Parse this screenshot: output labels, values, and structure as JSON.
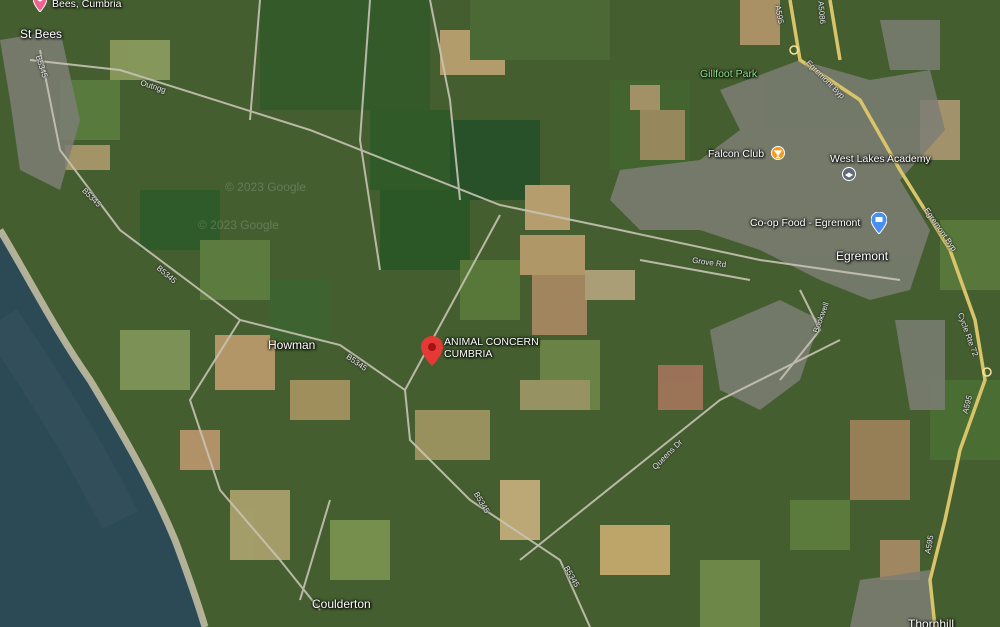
{
  "map": {
    "labels": {
      "st_bees": "St Bees",
      "st_bees_poi": "Bees, Cumbria",
      "howman": "Howman",
      "coulderton": "Coulderton",
      "egremont": "Egremont",
      "thornhill": "Thornhill"
    },
    "roads": {
      "b5345_a": "B5345",
      "b5345_b": "B5345",
      "b5345_c": "B5345",
      "b5345_d": "B5345",
      "b5345_e": "B5345",
      "b5345_f": "B5345",
      "a595_a": "A595",
      "a595_b": "A595",
      "a595_c": "A595",
      "a5086": "A5086",
      "egremont_byp_a": "Egremont Byp",
      "egremont_byp_b": "Egremont Byp",
      "outrigg": "Outrigg",
      "grove_rd": "Grove Rd",
      "queens_dr": "Queens Dr",
      "bookwell": "Bookwell",
      "cycle_rte": "Cycle Rte 72"
    },
    "pois": {
      "animal_concern": "ANIMAL CONCERN CUMBRIA",
      "gillfoot_park": "Gillfoot Park",
      "falcon_club": "Falcon Club",
      "west_lakes_academy": "West Lakes Academy",
      "coop_food": "Co-op Food - Egremont"
    },
    "watermark": "© 2023 Google",
    "colors": {
      "pin_red": "#e53935",
      "pin_orange": "#f29b1e",
      "pin_blue": "#4a8ef0",
      "pin_pink": "#f06292",
      "sea": "#2c4a56",
      "road_yellow": "#d9c46a"
    }
  }
}
